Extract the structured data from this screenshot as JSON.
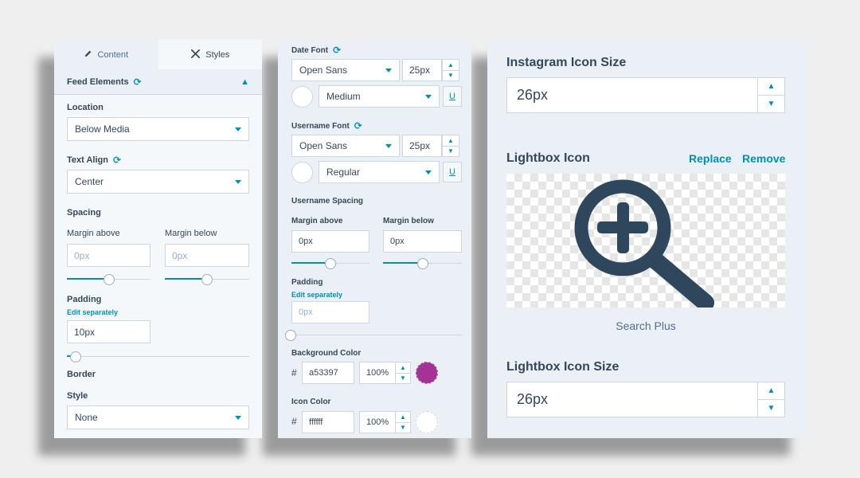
{
  "colors": {
    "accent": "#0091ae",
    "text": "#33475b",
    "background_swatch": "#a53397",
    "icon_color": "#ffffff",
    "icon_dark": "#2e475d"
  },
  "left_panel": {
    "tabs": [
      {
        "label": "Content",
        "icon": "pencil-icon"
      },
      {
        "label": "Styles",
        "icon": "brush-icon"
      }
    ],
    "section_title": "Feed Elements",
    "location": {
      "label": "Location",
      "value": "Below Media"
    },
    "text_align": {
      "label": "Text Align",
      "value": "Center"
    },
    "spacing": {
      "label": "Spacing",
      "margin_above": {
        "label": "Margin above",
        "placeholder": "0px",
        "level": 0.5
      },
      "margin_below": {
        "label": "Margin below",
        "placeholder": "0px",
        "level": 0.5
      }
    },
    "padding": {
      "label": "Padding",
      "edit_link": "Edit separately",
      "value": "10px",
      "level": 0.05
    },
    "border": {
      "label": "Border",
      "style_label": "Style",
      "style_value": "None"
    }
  },
  "middle_panel": {
    "date_font": {
      "label": "Date Font",
      "family": "Open Sans",
      "size": "25px",
      "weight": "Medium",
      "underline": "U"
    },
    "username_font": {
      "label": "Username Font",
      "family": "Open Sans",
      "size": "25px",
      "weight": "Regular",
      "underline": "U"
    },
    "username_spacing": {
      "label": "Username Spacing",
      "margin_above": {
        "label": "Margin above",
        "value": "0px",
        "level": 0.5
      },
      "margin_below": {
        "label": "Margin below",
        "value": "0px",
        "level": 0.5
      }
    },
    "padding": {
      "label": "Padding",
      "edit_link": "Edit separately",
      "placeholder": "0px",
      "level": 0
    },
    "background_color": {
      "label": "Background Color",
      "hash": "#",
      "hex": "a53397",
      "opacity": "100%"
    },
    "icon_color": {
      "label": "Icon Color",
      "hash": "#",
      "hex": "ffffff",
      "opacity": "100%"
    }
  },
  "right_panel": {
    "instagram_icon_size": {
      "label": "Instagram Icon Size",
      "value": "26px"
    },
    "lightbox_icon": {
      "label": "Lightbox Icon",
      "replace": "Replace",
      "remove": "Remove",
      "icon": "search-plus-icon",
      "caption": "Search Plus"
    },
    "lightbox_icon_size": {
      "label": "Lightbox Icon Size",
      "value": "26px"
    }
  }
}
